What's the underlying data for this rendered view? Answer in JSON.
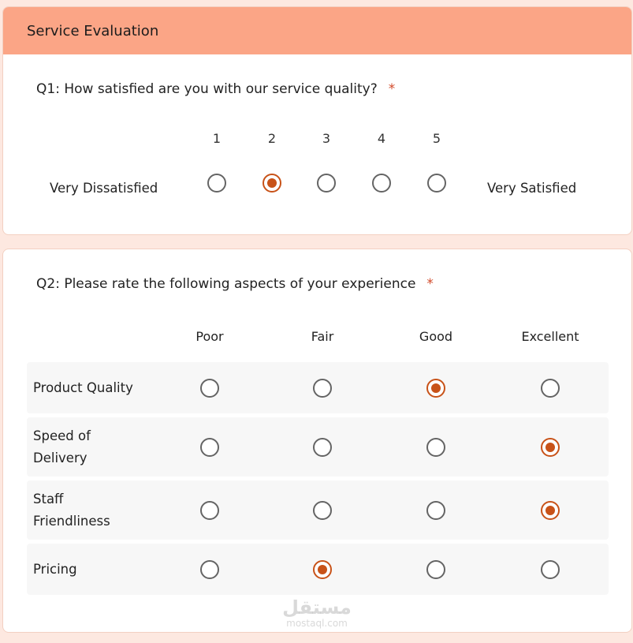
{
  "form": {
    "title": "Service Evaluation"
  },
  "q1": {
    "text": "Q1: How satisfied are you with our service quality?",
    "required_mark": "*",
    "scale": [
      "1",
      "2",
      "3",
      "4",
      "5"
    ],
    "min_label": "Very Dissatisfied",
    "max_label": "Very Satisfied",
    "selected": "2"
  },
  "q2": {
    "text": "Q2: Please rate the following aspects of your experience",
    "required_mark": "*",
    "columns": [
      "Poor",
      "Fair",
      "Good",
      "Excellent"
    ],
    "rows": [
      {
        "label": "Product Quality",
        "selected": "Good"
      },
      {
        "label": "Speed of Delivery",
        "selected": "Excellent"
      },
      {
        "label": "Staff Friendliness",
        "selected": "Excellent"
      },
      {
        "label": "Pricing",
        "selected": "Fair"
      }
    ]
  },
  "watermark": {
    "arabic": "مستقل",
    "latin": "mostaql.com"
  },
  "colors": {
    "header_bg": "#fba586",
    "page_bg": "#fde8e0",
    "accent": "#c85218",
    "required": "#d24a2a"
  }
}
